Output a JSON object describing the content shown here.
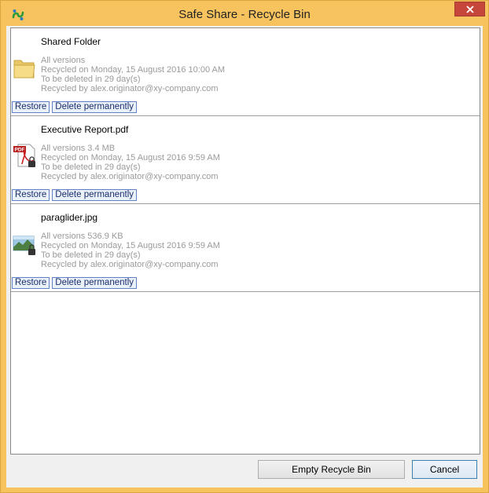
{
  "window": {
    "title": "Safe Share - Recycle Bin",
    "accent": "#f6c35e",
    "close_color": "#c7463b"
  },
  "items": [
    {
      "name": "Shared Folder",
      "icon": "folder-icon",
      "versions": "All versions",
      "recycled_on": "Recycled on Monday, 15 August 2016 10:00 AM",
      "to_be_deleted": "To be deleted in 29 day(s)",
      "recycled_by": "Recycled by alex.originator@xy-company.com",
      "restore_label": "Restore",
      "delete_label": "Delete permanently"
    },
    {
      "name": "Executive Report.pdf",
      "icon": "pdf-file-icon",
      "versions": "All versions 3.4 MB",
      "recycled_on": "Recycled on Monday, 15 August 2016 9:59 AM",
      "to_be_deleted": "To be deleted in 29 day(s)",
      "recycled_by": "Recycled by alex.originator@xy-company.com",
      "restore_label": "Restore",
      "delete_label": "Delete permanently"
    },
    {
      "name": "paraglider.jpg",
      "icon": "image-file-icon",
      "versions": "All versions 536.9 KB",
      "recycled_on": "Recycled on Monday, 15 August 2016 9:59 AM",
      "to_be_deleted": "To be deleted in 29 day(s)",
      "recycled_by": "Recycled by alex.originator@xy-company.com",
      "restore_label": "Restore",
      "delete_label": "Delete permanently"
    }
  ],
  "footer": {
    "empty_label": "Empty Recycle Bin",
    "cancel_label": "Cancel"
  }
}
